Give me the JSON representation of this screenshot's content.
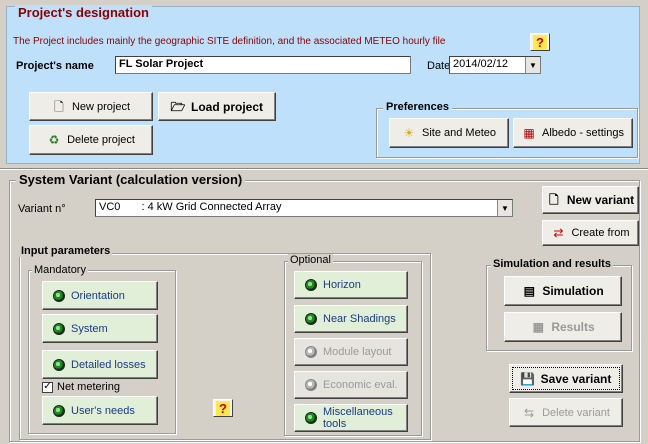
{
  "project": {
    "frame_title": "Project's designation",
    "description": "The Project includes mainly the geographic SITE definition, and the associated METEO  hourly file",
    "name_label": "Project's name",
    "name_value": "FL Solar Project",
    "date_label": "Date",
    "date_value": "2014/02/12",
    "new_project": "New project",
    "load_project": "Load project",
    "delete_project": "Delete project",
    "preferences_label": "Preferences",
    "site_meteo": "Site and Meteo",
    "albedo": "Albedo - settings",
    "help": "?"
  },
  "variant": {
    "frame_title": "System Variant (calculation version)",
    "variant_label": "Variant n°",
    "variant_code": "VC0",
    "variant_name": ": 4 kW Grid Connected Array",
    "new_variant": "New variant",
    "create_from": "Create from"
  },
  "input": {
    "title": "Input parameters",
    "mandatory_label": "Mandatory",
    "orientation": "Orientation",
    "system": "System",
    "detailed_losses": "Detailed losses",
    "net_metering": "Net metering",
    "net_metering_checked": true,
    "users_needs": "User's needs",
    "optional_label": "Optional",
    "horizon": "Horizon",
    "near_shadings": "Near Shadings",
    "module_layout": "Module layout",
    "economic_eval": "Economic eval.",
    "misc_tools": "Miscellaneous tools",
    "help": "?"
  },
  "simulation": {
    "title": "Simulation and results",
    "simulation": "Simulation",
    "results": "Results",
    "save_variant": "Save variant",
    "delete_variant": "Delete variant"
  }
}
